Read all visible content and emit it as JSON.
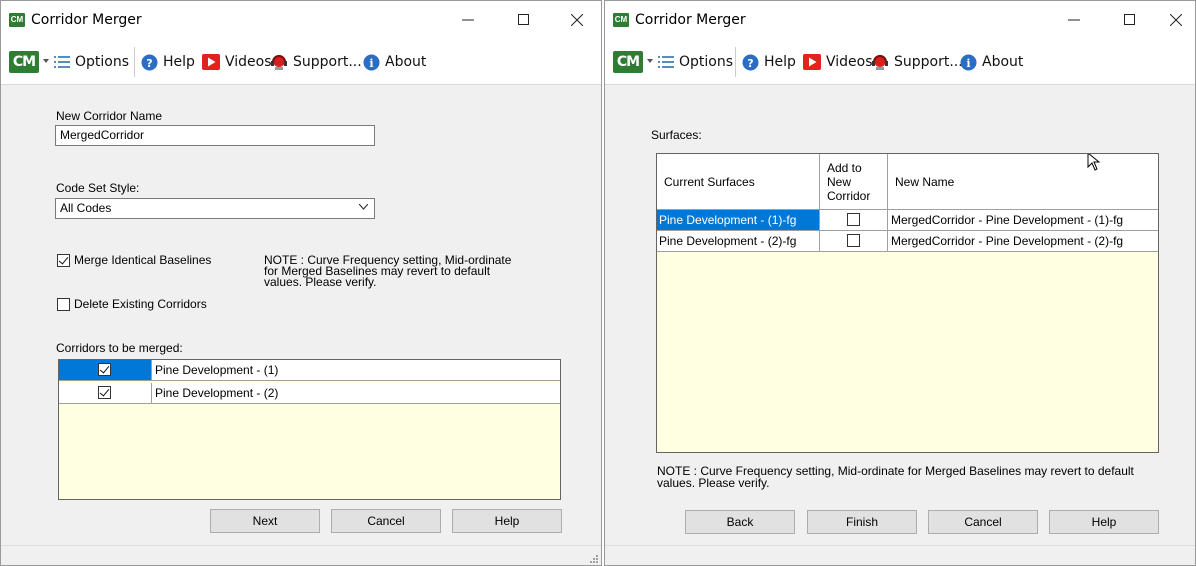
{
  "window1": {
    "title": "Corridor Merger",
    "toolbar": {
      "logo": "CM",
      "options": "Options",
      "help": "Help",
      "videos": "Videos",
      "support": "Support...",
      "about": "About"
    },
    "new_corridor_label": "New Corridor Name",
    "new_corridor_value": "MergedCorridor",
    "code_set_label": "Code Set Style:",
    "code_set_value": "All Codes",
    "merge_identical_label": "Merge Identical Baselines",
    "merge_identical_checked": true,
    "delete_existing_label": "Delete Existing Corridors",
    "delete_existing_checked": false,
    "note_line1": "NOTE : Curve Frequency setting, Mid-ordinate",
    "note_line2": "for Merged Baselines may revert to default",
    "note_line3": "values. Please verify.",
    "corridors_label": "Corridors to be merged:",
    "corridors": [
      {
        "name": "Pine Development - (1)",
        "checked": true
      },
      {
        "name": "Pine Development - (2)",
        "checked": true
      }
    ],
    "buttons": {
      "next": "Next",
      "cancel": "Cancel",
      "help": "Help"
    }
  },
  "window2": {
    "title": "Corridor Merger",
    "toolbar": {
      "logo": "CM",
      "options": "Options",
      "help": "Help",
      "videos": "Videos",
      "support": "Support...",
      "about": "About"
    },
    "surfaces_label": "Surfaces:",
    "headers": {
      "current": "Current Surfaces",
      "add_l1": "Add to",
      "add_l2": "New",
      "add_l3": "Corridor",
      "new_name": "New Name"
    },
    "surfaces": [
      {
        "current": "Pine Development - (1)-fg",
        "add": false,
        "new_name": "MergedCorridor - Pine Development - (1)-fg"
      },
      {
        "current": "Pine Development - (2)-fg",
        "add": false,
        "new_name": "MergedCorridor - Pine Development - (2)-fg"
      }
    ],
    "note_line1": "NOTE : Curve Frequency setting, Mid-ordinate for Merged Baselines may revert to default",
    "note_line2": "values. Please verify.",
    "buttons": {
      "back": "Back",
      "finish": "Finish",
      "cancel": "Cancel",
      "help": "Help"
    }
  }
}
